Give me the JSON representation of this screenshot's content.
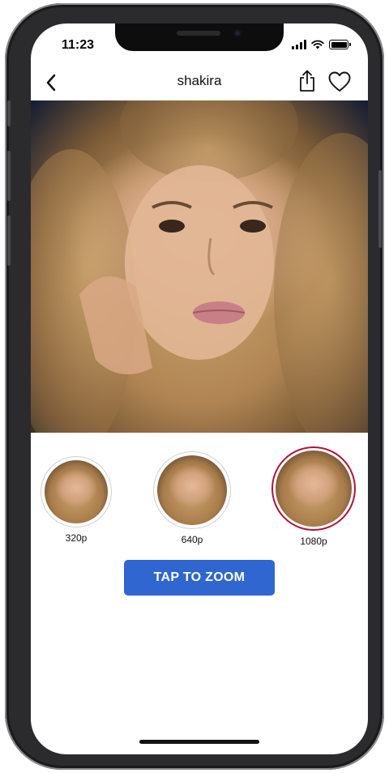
{
  "status_bar": {
    "time": "11:23"
  },
  "nav": {
    "title": "shakira",
    "back_icon": "chevron-left-icon",
    "share_icon": "share-icon",
    "favorite_icon": "heart-outline-icon"
  },
  "resolutions": [
    {
      "label": "320p",
      "selected": false
    },
    {
      "label": "640p",
      "selected": false
    },
    {
      "label": "1080p",
      "selected": true
    }
  ],
  "zoom_button": {
    "label": "TAP TO ZOOM"
  },
  "colors": {
    "accent_button": "#2f66d0",
    "selected_ring": "#b0123d"
  }
}
